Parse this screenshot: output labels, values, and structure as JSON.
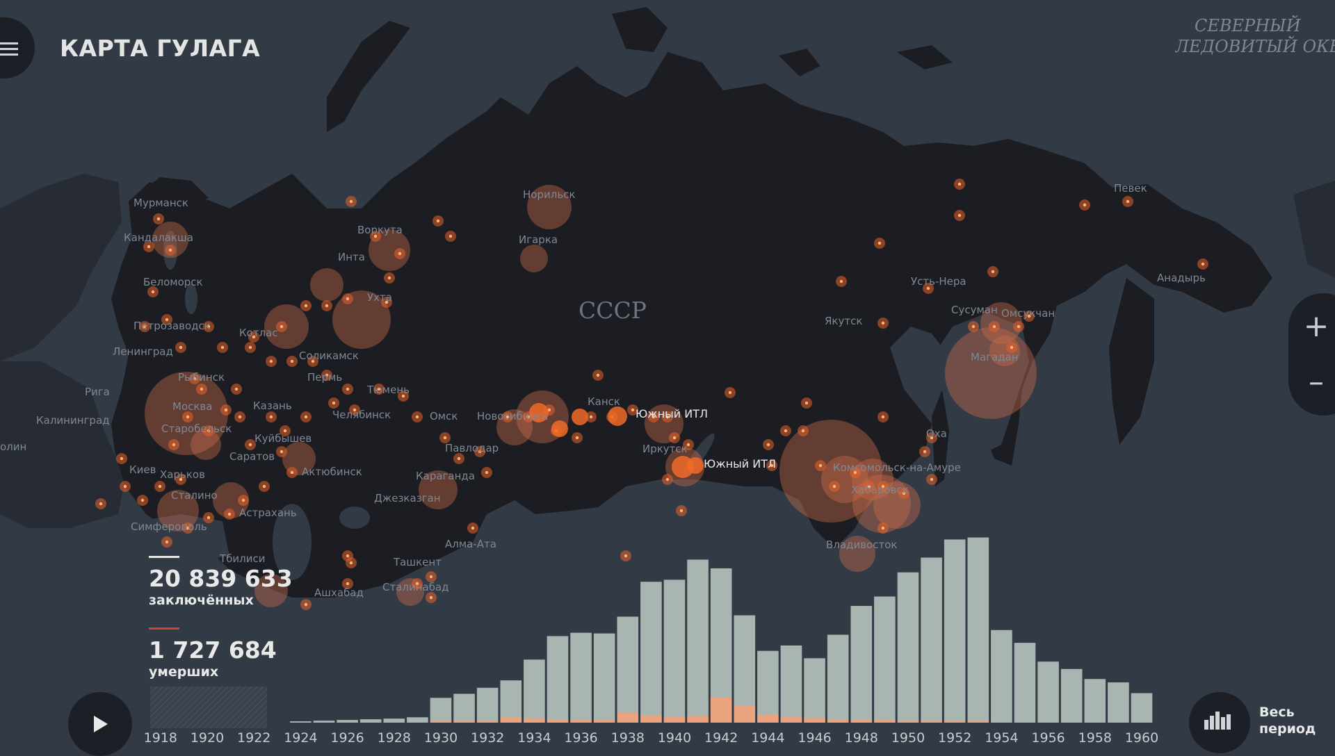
{
  "app": {
    "title": "КАРТА ГУЛАГА"
  },
  "map": {
    "ocean_label_line1": "СЕВЕРНЫЙ",
    "ocean_label_line2": "ЛЕДОВИТЫЙ ОКЕ",
    "country_label": "СССР",
    "city_labels": [
      "Мурманск",
      "Кандалакша",
      "Беломорск",
      "Петрозаводск",
      "Ленинград",
      "Воркута",
      "Инта",
      "Ухта",
      "Котлас",
      "Соликамск",
      "Пермь",
      "Тюмень",
      "Рыбинск",
      "Москва",
      "Казань",
      "Челябинск",
      "Старобельск",
      "Куйбышев",
      "Саратов",
      "Актюбинск",
      "Омск",
      "Новосибирск",
      "Канск",
      "Павлодар",
      "Караганда",
      "Джезказган",
      "Рига",
      "Калининград",
      "Киев",
      "Харьков",
      "Сталино",
      "Астрахань",
      "Симферополь",
      "Тбилиси",
      "Ашхабад",
      "Ташкент",
      "Сталинабад",
      "Алма-Ата",
      "Норильск",
      "Игарка",
      "Иркутск",
      "Якутск",
      "Усть-Нера",
      "Сусуман",
      "Омсукчан",
      "Магадан",
      "Певек",
      "Анадырь",
      "Оха",
      "Комсомольск-на-Амуре",
      "Хабаровск",
      "Владивосток",
      "Южный ИТЛ",
      "Южный ИТЛ",
      "олин"
    ],
    "colors": {
      "land": "#1b1d22",
      "water": "#323a45",
      "camp": "#e8622a",
      "halo": "#c86b4a"
    },
    "zoom": {
      "in_icon": "plus-icon",
      "out_icon": "minus-icon"
    }
  },
  "stats": {
    "prisoners_value": "20 839 633",
    "prisoners_label": "заключённых",
    "deaths_value": "1 727 684",
    "deaths_label": "умерших",
    "prisoners_color": "#e6e6e6",
    "deaths_color": "#d3432b"
  },
  "controls": {
    "play_icon": "play-icon",
    "period_icon": "bar-chart-icon",
    "period_label_line1": "Весь",
    "period_label_line2": "период"
  },
  "chart_data": {
    "type": "bar",
    "title": "",
    "xlabel": "",
    "ylabel": "",
    "tick_labels": [
      "1918",
      "1920",
      "1922",
      "1924",
      "1926",
      "1928",
      "1930",
      "1932",
      "1934",
      "1936",
      "1938",
      "1940",
      "1942",
      "1944",
      "1946",
      "1948",
      "1950",
      "1952",
      "1954",
      "1956",
      "1958",
      "1960"
    ],
    "categories": [
      "1918",
      "1919",
      "1920",
      "1921",
      "1922",
      "1923",
      "1924",
      "1925",
      "1926",
      "1927",
      "1928",
      "1929",
      "1930",
      "1931",
      "1932",
      "1933",
      "1934",
      "1935",
      "1936",
      "1937",
      "1938",
      "1939",
      "1940",
      "1941",
      "1942",
      "1943",
      "1944",
      "1945",
      "1946",
      "1947",
      "1948",
      "1949",
      "1950",
      "1951",
      "1952",
      "1953",
      "1954",
      "1955",
      "1956",
      "1957",
      "1958",
      "1959",
      "1960"
    ],
    "series": [
      {
        "values": [
          0,
          0,
          0,
          0,
          0,
          0,
          2,
          3,
          4,
          5,
          6,
          8,
          37,
          43,
          52,
          63,
          94,
          129,
          134,
          133,
          158,
          210,
          213,
          243,
          230,
          160,
          107,
          115,
          96,
          131,
          174,
          188,
          224,
          246,
          273,
          276,
          138,
          119,
          91,
          80,
          65,
          60,
          44
        ]
      },
      {
        "values": [
          0,
          0,
          0,
          0,
          0,
          0,
          0,
          0,
          0,
          0,
          0,
          0,
          3,
          3,
          3,
          8,
          6,
          5,
          4,
          4,
          15,
          11,
          9,
          10,
          38,
          25,
          12,
          9,
          7,
          5,
          5,
          4,
          3,
          3,
          3,
          3,
          1,
          1,
          0,
          0,
          0,
          0,
          0
        ]
      }
    ],
    "colors": [
      "#a9b5b1",
      "#eaa27f"
    ],
    "ylim": [
      0,
      290
    ],
    "legend": "none"
  }
}
